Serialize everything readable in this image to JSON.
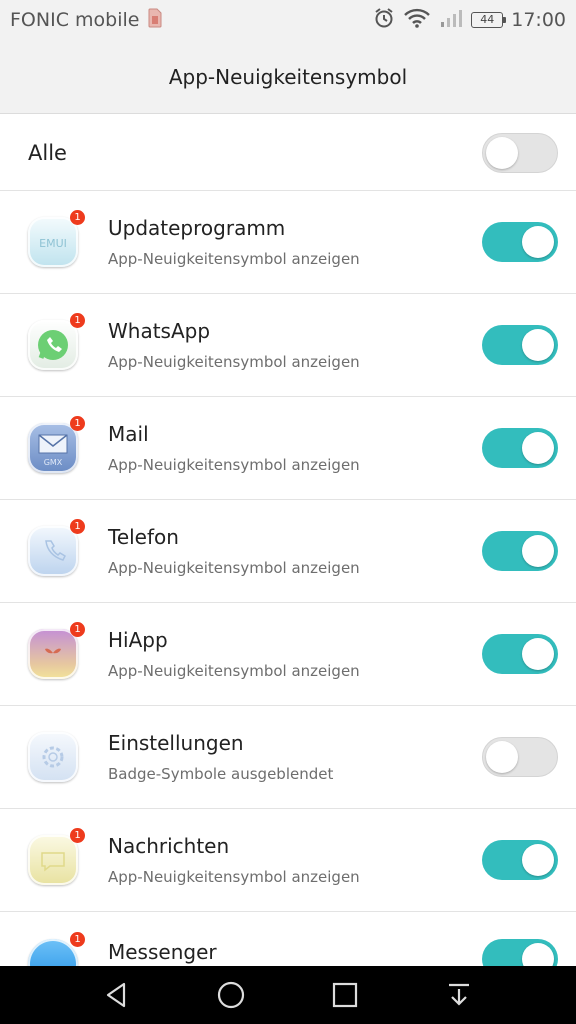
{
  "status_bar": {
    "carrier": "FONIC mobile",
    "battery": "44",
    "time": "17:00"
  },
  "header": {
    "title": "App-Neuigkeitensymbol"
  },
  "all_row": {
    "label": "Alle",
    "enabled": false
  },
  "apps": [
    {
      "name": "Updateprogramm",
      "subtitle": "App-Neuigkeitensymbol anzeigen",
      "badge": "1",
      "enabled": true,
      "icon": "emui-update-icon",
      "icon_text": "EMUI",
      "icon_color": "#cfeaf2"
    },
    {
      "name": "WhatsApp",
      "subtitle": "App-Neuigkeitensymbol anzeigen",
      "badge": "1",
      "enabled": true,
      "icon": "whatsapp-icon",
      "icon_text": "",
      "icon_color": "#e9f2ea"
    },
    {
      "name": "Mail",
      "subtitle": "App-Neuigkeitensymbol anzeigen",
      "badge": "1",
      "enabled": true,
      "icon": "mail-icon",
      "icon_text": "GMX",
      "icon_color": "#7f9ccc"
    },
    {
      "name": "Telefon",
      "subtitle": "App-Neuigkeitensymbol anzeigen",
      "badge": "1",
      "enabled": true,
      "icon": "phone-icon",
      "icon_text": "",
      "icon_color": "#cfe0f3"
    },
    {
      "name": "HiApp",
      "subtitle": "App-Neuigkeitensymbol anzeigen",
      "badge": "1",
      "enabled": true,
      "icon": "hiapp-icon",
      "icon_text": "",
      "icon_color": "#c9a6d6"
    },
    {
      "name": "Einstellungen",
      "subtitle": "Badge-Symbole ausgeblendet",
      "badge": "",
      "enabled": false,
      "icon": "settings-gear-icon",
      "icon_text": "",
      "icon_color": "#dfe8f4"
    },
    {
      "name": "Nachrichten",
      "subtitle": "App-Neuigkeitensymbol anzeigen",
      "badge": "1",
      "enabled": true,
      "icon": "messages-icon",
      "icon_text": "",
      "icon_color": "#efeab8"
    },
    {
      "name": "Messenger",
      "subtitle": "",
      "badge": "1",
      "enabled": true,
      "icon": "messenger-icon",
      "icon_text": "",
      "icon_color": "#3ea8f0"
    }
  ],
  "colors": {
    "accent": "#33bdbd",
    "badge": "#ee3b1d"
  }
}
